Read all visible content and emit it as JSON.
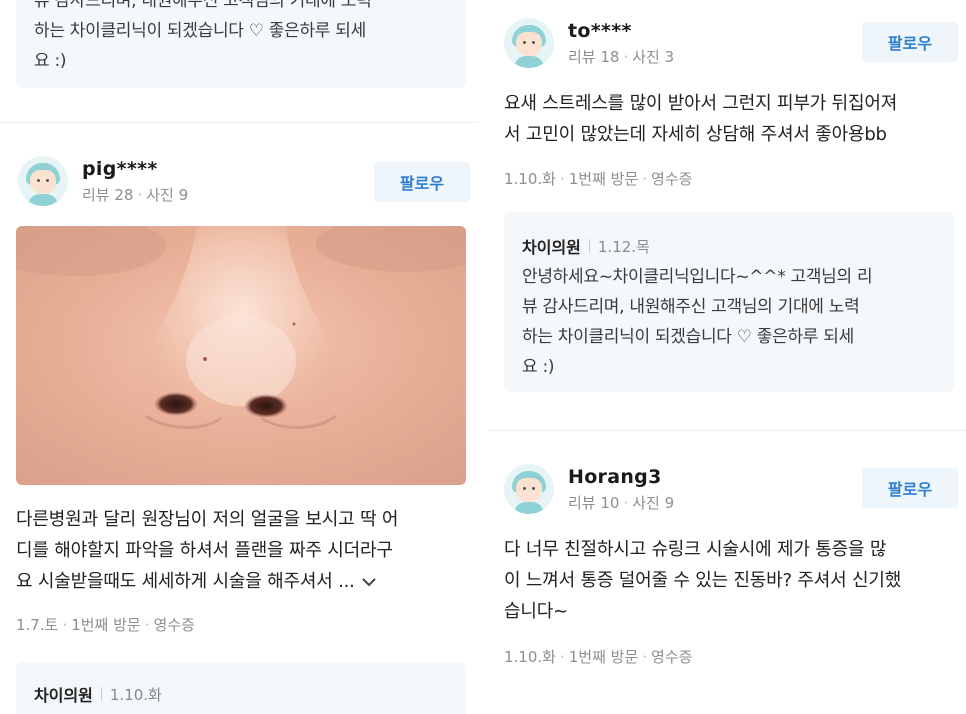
{
  "left": {
    "top_reply": {
      "line1": "뷰 감사드리며, 내원해주신 고객님의 기대에 노력",
      "line2": "하는 차이클리닉이 되겠습니다 ♡ 좋은하루 되세",
      "line3": "요 :)"
    },
    "review": {
      "username": "pig****",
      "reviews_label": "리뷰 28",
      "photos_label": "사진 9",
      "follow_label": "팔로우",
      "text_line1": "다른병원과 달리 원장님이 저의 얼굴을 보시고 딱 어",
      "text_line2": "디를 해야할지 파악을 하셔서 플랜을 짜주 시더라구",
      "text_line3": "요 시술받을때도 세세하게 시술을 해주셔서 ...",
      "date": "1.7.토",
      "visit": "1번째 방문",
      "receipt": "영수증",
      "reply_author": "차이의원",
      "reply_date": "1.10.화"
    }
  },
  "right": {
    "review1": {
      "username": "to****",
      "reviews_label": "리뷰 18",
      "photos_label": "사진 3",
      "follow_label": "팔로우",
      "text_line1": "요새 스트레스를 많이 받아서 그런지 피부가 뒤집어져",
      "text_line2": "서 고민이 많았는데 자세히 상담해 주셔서 좋아용bb",
      "date": "1.10.화",
      "visit": "1번째 방문",
      "receipt": "영수증",
      "reply_author": "차이의원",
      "reply_date": "1.12.목",
      "reply_line1": "안녕하세요~차이클리닉입니다~^^* 고객님의 리",
      "reply_line2": "뷰 감사드리며, 내원해주신 고객님의 기대에 노력",
      "reply_line3": "하는 차이클리닉이 되겠습니다 ♡ 좋은하루 되세",
      "reply_line4": "요 :)"
    },
    "review2": {
      "username": "Horang3",
      "reviews_label": "리뷰 10",
      "photos_label": "사진 9",
      "follow_label": "팔로우",
      "text_line1": "다 너무 친절하시고 슈링크 시술시에 제가 통증을 많",
      "text_line2": "이 느껴서 통증 덜어줄 수 있는 진동바? 주셔서 신기했",
      "text_line3": "습니다~",
      "date": "1.10.화",
      "visit": "1번째 방문",
      "receipt": "영수증"
    }
  },
  "colors": {
    "follow_text": "#2f7fd1",
    "follow_bg": "#eef5fb",
    "reply_bg": "#f4f8fb",
    "meta_gray": "#8f8f8f"
  },
  "icons": {
    "avatar": "avatar-icon",
    "more": "chevron-down-icon"
  }
}
